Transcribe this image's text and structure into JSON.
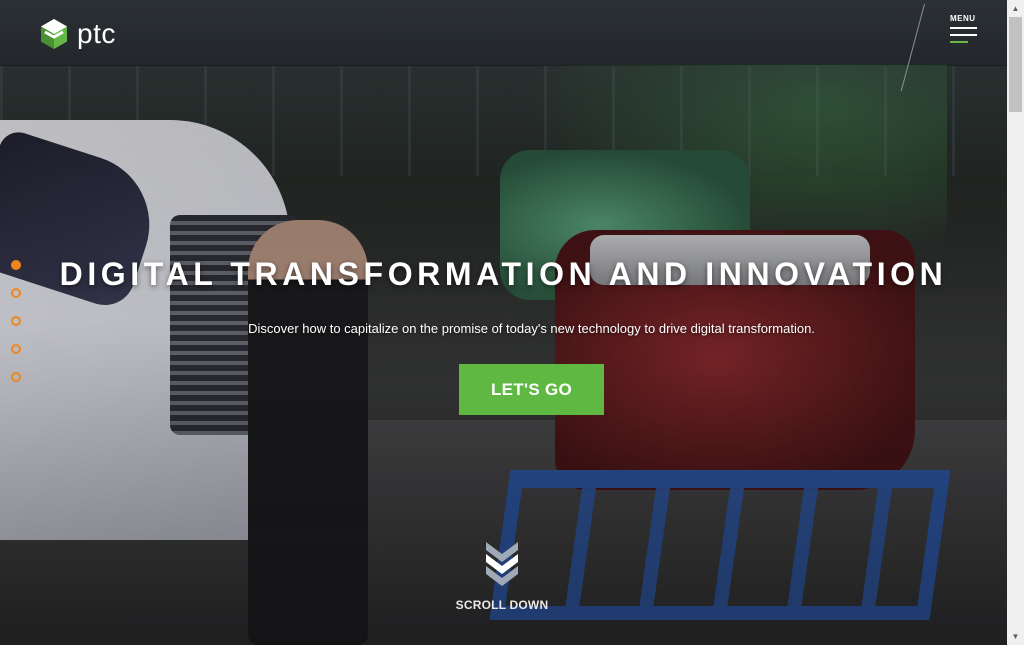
{
  "header": {
    "logo_text": "ptc",
    "menu_label": "MENU",
    "accent_color": "#66b846"
  },
  "hero": {
    "headline": "DIGITAL TRANSFORMATION AND INNOVATION",
    "subline": "Discover how to capitalize on the promise of today's new technology to drive digital transformation.",
    "cta_label": "LET'S GO",
    "cta_color": "#5fb841",
    "scroll_label": "SCROLL DOWN",
    "slides": {
      "count": 5,
      "active_index": 0,
      "indicator_color": "#f0851d"
    }
  },
  "icons": {
    "logo": "ptc-hexagon-logo-icon",
    "menu": "hamburger-menu-icon",
    "scroll": "double-chevron-down-icon"
  }
}
